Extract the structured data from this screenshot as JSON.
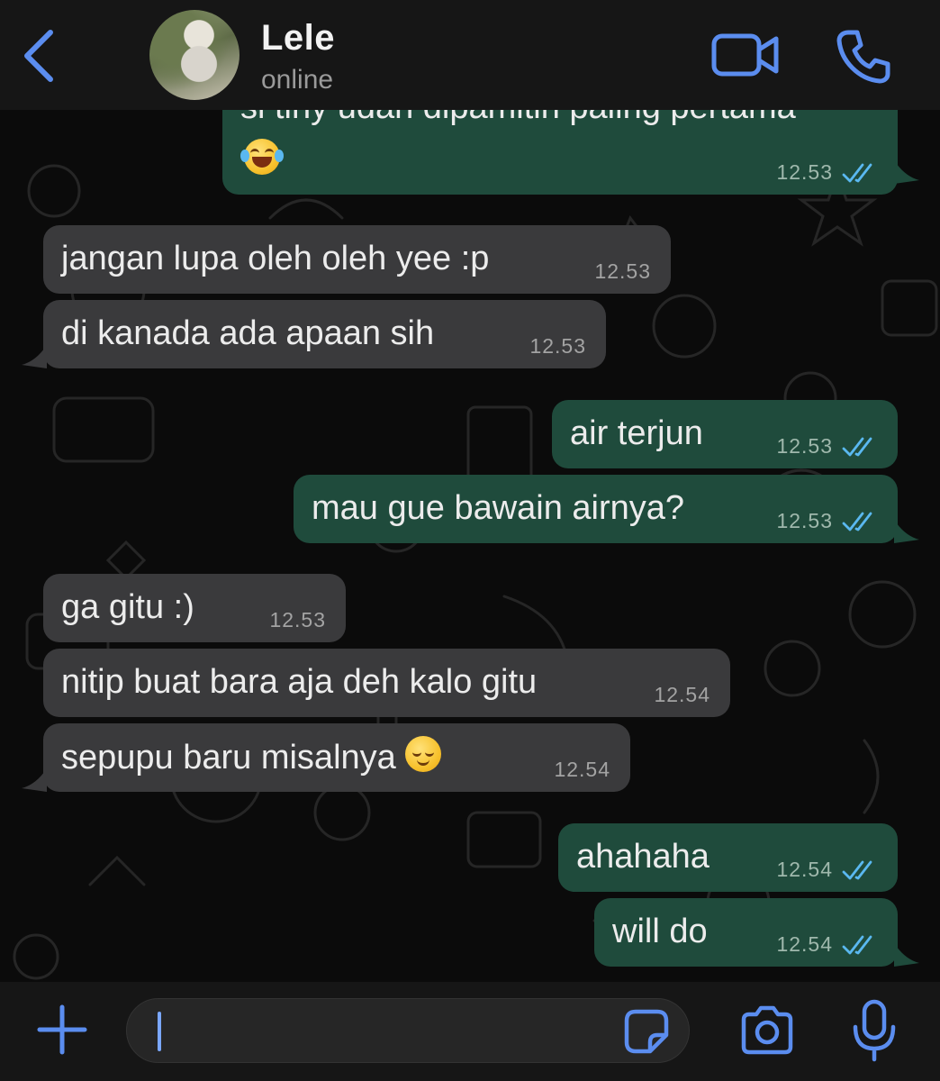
{
  "header": {
    "contact_name": "Lele",
    "status": "online",
    "accent_color": "#5b8def"
  },
  "messages": [
    {
      "direction": "out",
      "text": "si tiny udah dipamitin paling pertama",
      "emoji": "face-with-tears-of-joy",
      "time": "12.53",
      "read": true
    },
    {
      "direction": "in",
      "text": "jangan lupa oleh oleh yee :p",
      "time": "12.53"
    },
    {
      "direction": "in",
      "text": "di kanada ada apaan sih",
      "time": "12.53"
    },
    {
      "direction": "out",
      "text": "air terjun",
      "time": "12.53",
      "read": true
    },
    {
      "direction": "out",
      "text": "mau gue bawain airnya?",
      "time": "12.53",
      "read": true
    },
    {
      "direction": "in",
      "text": "ga gitu :)",
      "time": "12.53"
    },
    {
      "direction": "in",
      "text": "nitip buat bara aja deh kalo gitu",
      "time": "12.54"
    },
    {
      "direction": "in",
      "text": "sepupu baru misalnya",
      "emoji": "relieved-face",
      "time": "12.54"
    },
    {
      "direction": "out",
      "text": "ahahaha",
      "time": "12.54",
      "read": true
    },
    {
      "direction": "out",
      "text": "will do",
      "time": "12.54",
      "read": true
    }
  ],
  "input": {
    "value": ""
  },
  "colors": {
    "incoming_bubble": "#3a3a3c",
    "outgoing_bubble": "#1f4b3c",
    "read_ticks": "#5ab8f0",
    "background": "#0b0b0b"
  }
}
